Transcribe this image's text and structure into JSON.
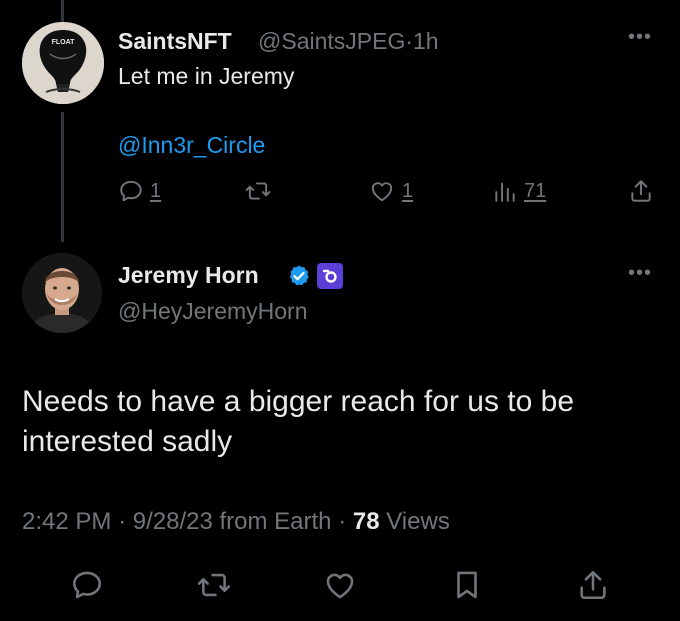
{
  "reply": {
    "display_name": "SaintsNFT",
    "handle": "@SaintsJPEG",
    "separator": "·",
    "time": "1h",
    "text": "Let me in Jeremy",
    "mention": "@Inn3r_Circle",
    "avatar_label": "FLOAT",
    "actions": {
      "reply_count": "1",
      "like_count": "1",
      "views_count": "71"
    }
  },
  "tweet": {
    "display_name": "Jeremy Horn",
    "handle": "@HeyJeremyHorn",
    "text": "Needs to have a bigger reach for us to be interested sadly",
    "time": "2:42 PM",
    "date": "9/28/23",
    "source": "from Earth",
    "views_count": "78",
    "views_label": "Views",
    "separator": "·"
  },
  "colors": {
    "background": "#000000",
    "text": "#e7e9ea",
    "muted": "#71767b",
    "link": "#1d9bf0",
    "verified": "#1d9bf0",
    "affiliate_badge": "#5b3fd6"
  },
  "icons": {
    "more": "more-horizontal-icon",
    "reply": "reply-icon",
    "retweet": "retweet-icon",
    "like": "heart-icon",
    "views": "analytics-icon",
    "share": "share-icon",
    "bookmark": "bookmark-icon",
    "verified": "verified-badge-icon"
  }
}
